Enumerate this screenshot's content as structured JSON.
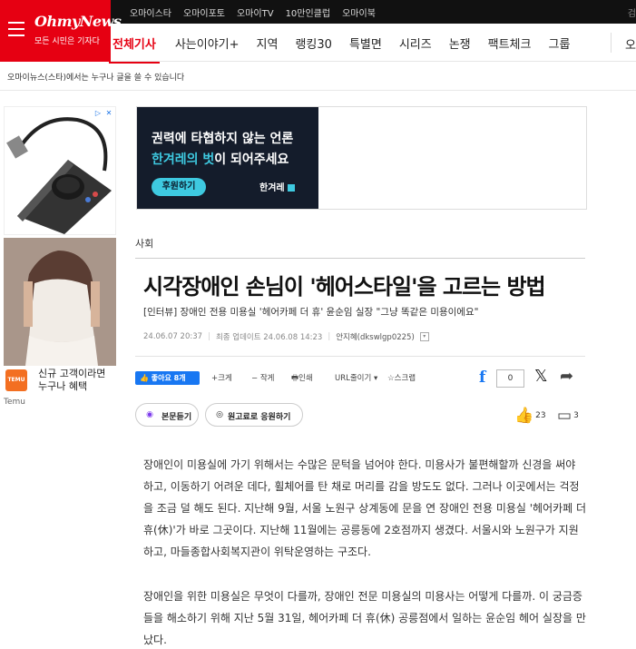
{
  "top_links": [
    "오마이스타",
    "오마이포토",
    "오마이TV",
    "10만인클럽",
    "오마이북"
  ],
  "top_right_partial": "검",
  "logo": {
    "brand": "OhmyNews",
    "slogan": "모든 시민은 기자다"
  },
  "nav": {
    "items": [
      "전체기사",
      "사는이야기+",
      "지역",
      "랭킹30",
      "특별면",
      "시리즈",
      "논쟁",
      "팩트체크",
      "그룹"
    ],
    "cut_item": "오"
  },
  "notice": "오마이뉴스(스타)에서는 누구나 글을 쓸 수 있습니다",
  "left_ad": {
    "badges": [
      "▷",
      "✕"
    ],
    "promo_text": "신규 고객이라면 누구나 혜택",
    "brand": "Temu",
    "logo_text": "TEMU"
  },
  "banner": {
    "line1": "권력에 타협하지 않는 언론",
    "line2_highlight": "한겨레의 벗",
    "line2_rest": "이 되어주세요",
    "button": "후원하기",
    "logo": "한겨레"
  },
  "article": {
    "section": "사회",
    "headline": "시각장애인 손님이 '헤어스타일'을 고르는 방법",
    "subhead": "[인터뷰] 장애인 전용 미용실 '헤어카페 더 휴' 윤순임 실장 \"그냥 똑같은 미용이에요\"",
    "published": "24.06.07 20:37",
    "updated": "최종 업데이트 24.06.08 14:23",
    "author": "안지혜(dkswlgp0225)"
  },
  "toolbar": {
    "like": "👍 좋아요 8개",
    "font_up": "+크게",
    "font_down": "− 작게",
    "print": "🖶인쇄",
    "url": "URL줄이기 ▾",
    "scrap": "☆스크랩",
    "fb_icon": "facebook-icon",
    "share_count": "0"
  },
  "listen": {
    "listen_label": "본문듣기",
    "support_label": "원고료로 응원하기",
    "likes": "23",
    "comments": "3"
  },
  "body": [
    "장애인이 미용실에 가기 위해서는 수많은 문턱을 넘어야 한다. 미용사가 불편해할까 신경을 써야 하고, 이동하기 어려운 데다, 휠체어를 탄 채로 머리를 감을 방도도 없다. 그러나 이곳에서는 걱정을 조금 덜 해도 된다. 지난해 9월, 서울 노원구 상계동에 문을 연 장애인 전용 미용실 '헤어카페 더 휴(休)'가 바로 그곳이다. 지난해 11월에는 공릉동에 2호점까지 생겼다. 서울시와 노원구가 지원하고, 마들종합사회복지관이 위탁운영하는 구조다.",
    "장애인을 위한 미용실은 무엇이 다를까, 장애인 전문 미용실의 미용사는 어떻게 다를까. 이 궁금증들을 해소하기 위해 지난 5월 31일, 헤어카페 더 휴(休) 공릉점에서 일하는 윤순임 헤어 실장을 만났다."
  ],
  "colors": {
    "brand_red": "#e60012",
    "facebook_blue": "#1877f2",
    "banner_accent": "#3ec9e0"
  }
}
